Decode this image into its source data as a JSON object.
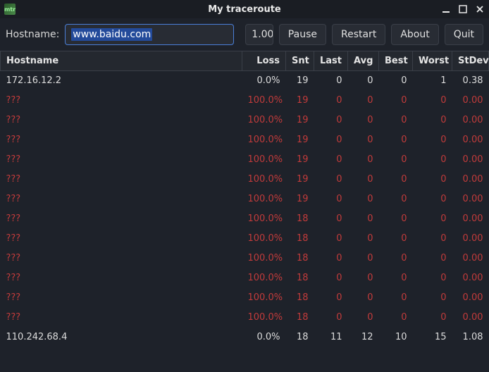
{
  "window": {
    "title": "My traceroute",
    "app_icon": "mtr"
  },
  "toolbar": {
    "hostname_label": "Hostname:",
    "hostname_value": "www.baidu.com",
    "interval": "1.00",
    "pause": "Pause",
    "restart": "Restart",
    "about": "About",
    "quit": "Quit"
  },
  "columns": [
    "Hostname",
    "Loss",
    "Snt",
    "Last",
    "Avg",
    "Best",
    "Worst",
    "StDev"
  ],
  "rows": [
    {
      "host": "172.16.12.2",
      "loss": "0.0%",
      "snt": "19",
      "last": "0",
      "avg": "0",
      "best": "0",
      "worst": "1",
      "stdev": "0.38",
      "state": "normal"
    },
    {
      "host": "???",
      "loss": "100.0%",
      "snt": "19",
      "last": "0",
      "avg": "0",
      "best": "0",
      "worst": "0",
      "stdev": "0.00",
      "state": "lost"
    },
    {
      "host": "???",
      "loss": "100.0%",
      "snt": "19",
      "last": "0",
      "avg": "0",
      "best": "0",
      "worst": "0",
      "stdev": "0.00",
      "state": "lost"
    },
    {
      "host": "???",
      "loss": "100.0%",
      "snt": "19",
      "last": "0",
      "avg": "0",
      "best": "0",
      "worst": "0",
      "stdev": "0.00",
      "state": "lost"
    },
    {
      "host": "???",
      "loss": "100.0%",
      "snt": "19",
      "last": "0",
      "avg": "0",
      "best": "0",
      "worst": "0",
      "stdev": "0.00",
      "state": "lost"
    },
    {
      "host": "???",
      "loss": "100.0%",
      "snt": "19",
      "last": "0",
      "avg": "0",
      "best": "0",
      "worst": "0",
      "stdev": "0.00",
      "state": "lost"
    },
    {
      "host": "???",
      "loss": "100.0%",
      "snt": "19",
      "last": "0",
      "avg": "0",
      "best": "0",
      "worst": "0",
      "stdev": "0.00",
      "state": "lost"
    },
    {
      "host": "???",
      "loss": "100.0%",
      "snt": "18",
      "last": "0",
      "avg": "0",
      "best": "0",
      "worst": "0",
      "stdev": "0.00",
      "state": "lost"
    },
    {
      "host": "???",
      "loss": "100.0%",
      "snt": "18",
      "last": "0",
      "avg": "0",
      "best": "0",
      "worst": "0",
      "stdev": "0.00",
      "state": "lost"
    },
    {
      "host": "???",
      "loss": "100.0%",
      "snt": "18",
      "last": "0",
      "avg": "0",
      "best": "0",
      "worst": "0",
      "stdev": "0.00",
      "state": "lost"
    },
    {
      "host": "???",
      "loss": "100.0%",
      "snt": "18",
      "last": "0",
      "avg": "0",
      "best": "0",
      "worst": "0",
      "stdev": "0.00",
      "state": "lost"
    },
    {
      "host": "???",
      "loss": "100.0%",
      "snt": "18",
      "last": "0",
      "avg": "0",
      "best": "0",
      "worst": "0",
      "stdev": "0.00",
      "state": "lost"
    },
    {
      "host": "???",
      "loss": "100.0%",
      "snt": "18",
      "last": "0",
      "avg": "0",
      "best": "0",
      "worst": "0",
      "stdev": "0.00",
      "state": "lost"
    },
    {
      "host": "110.242.68.4",
      "loss": "0.0%",
      "snt": "18",
      "last": "11",
      "avg": "12",
      "best": "10",
      "worst": "15",
      "stdev": "1.08",
      "state": "normal"
    }
  ]
}
